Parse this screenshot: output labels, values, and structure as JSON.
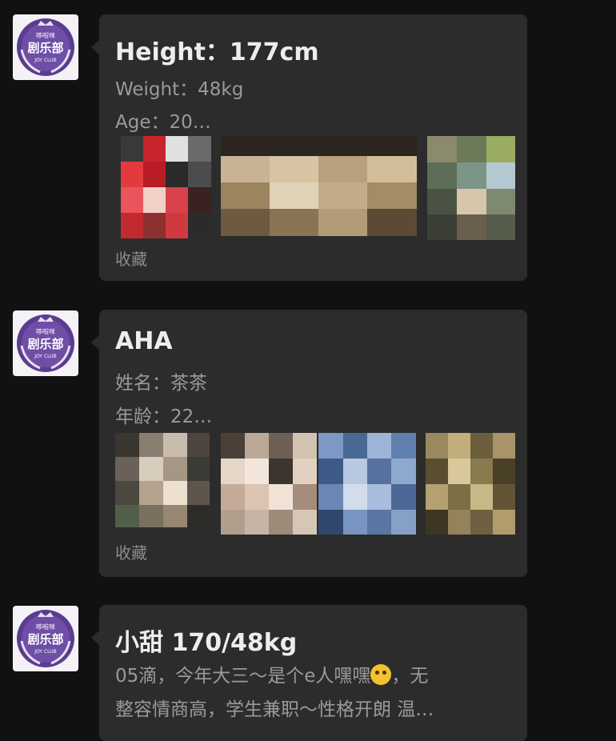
{
  "club": {
    "logo_top": "哆啦咪",
    "logo_main": "剧乐部",
    "logo_bottom": "JOY CLUB"
  },
  "messages": [
    {
      "title": "Height：177cm",
      "line1": "Weight：48kg",
      "line2": "Age：20…",
      "footer": "收藏"
    },
    {
      "title": "AHA",
      "line1": "姓名：茶茶",
      "line2": "年龄：22…",
      "footer": "收藏"
    },
    {
      "title": "小甜 170/48kg",
      "desc_line1_a": "05滴，今年大三～是个e人嘿嘿",
      "desc_line1_b": "，无",
      "desc_line2": "整容情商高，学生兼职～性格开朗 温…",
      "emoji": "smirking-cat-emoji"
    }
  ]
}
